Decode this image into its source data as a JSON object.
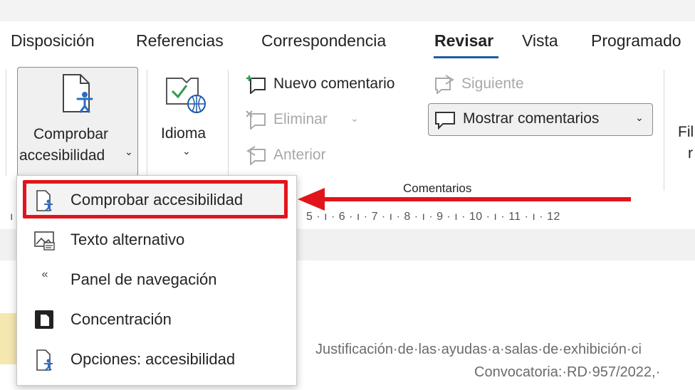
{
  "tabs": [
    {
      "label": "Disposición"
    },
    {
      "label": "Referencias"
    },
    {
      "label": "Correspondencia"
    },
    {
      "label": "Revisar",
      "active": true
    },
    {
      "label": "Vista"
    },
    {
      "label": "Programado"
    }
  ],
  "ribbon": {
    "accessibility_button": {
      "line1": "Comprobar",
      "line2": "accesibilidad",
      "chevron": "⌄",
      "icon": "accessibility-check-icon"
    },
    "language_button": {
      "label": "Idioma",
      "chevron": "⌄",
      "icon": "language-icon"
    },
    "comments": {
      "new_comment": "Nuevo comentario",
      "delete": "Eliminar",
      "delete_chevron": "⌄",
      "previous": "Anterior",
      "next": "Siguiente",
      "show_comments": "Mostrar comentarios",
      "show_chevron": "⌄",
      "group_label": "Comentarios"
    },
    "cut_right_1": "Fil",
    "cut_right_2": "r"
  },
  "ruler": {
    "text": "5 · ı · 6 · ı · 7 · ı · 8 · ı · 9 · ı · 10 · ı · 11 · ı · 12"
  },
  "menu": {
    "items": [
      {
        "label": "Comprobar accesibilidad",
        "icon": "accessibility-check-icon"
      },
      {
        "label": "Texto alternativo",
        "icon": "alt-text-icon"
      },
      {
        "label": "Panel de navegación",
        "icon": "navigation-pane-icon",
        "glyph": "«"
      },
      {
        "label": "Concentración",
        "icon": "focus-icon"
      },
      {
        "label": "Opciones: accesibilidad",
        "icon": "accessibility-options-icon"
      }
    ]
  },
  "document": {
    "line1": "Justificación·de·las·ayudas·a·salas·de·exhibición·ci",
    "line2": "Convocatoria:·RD·957/2022,·"
  },
  "colors": {
    "accent": "#1d5aa7",
    "highlight": "#e2141b"
  }
}
